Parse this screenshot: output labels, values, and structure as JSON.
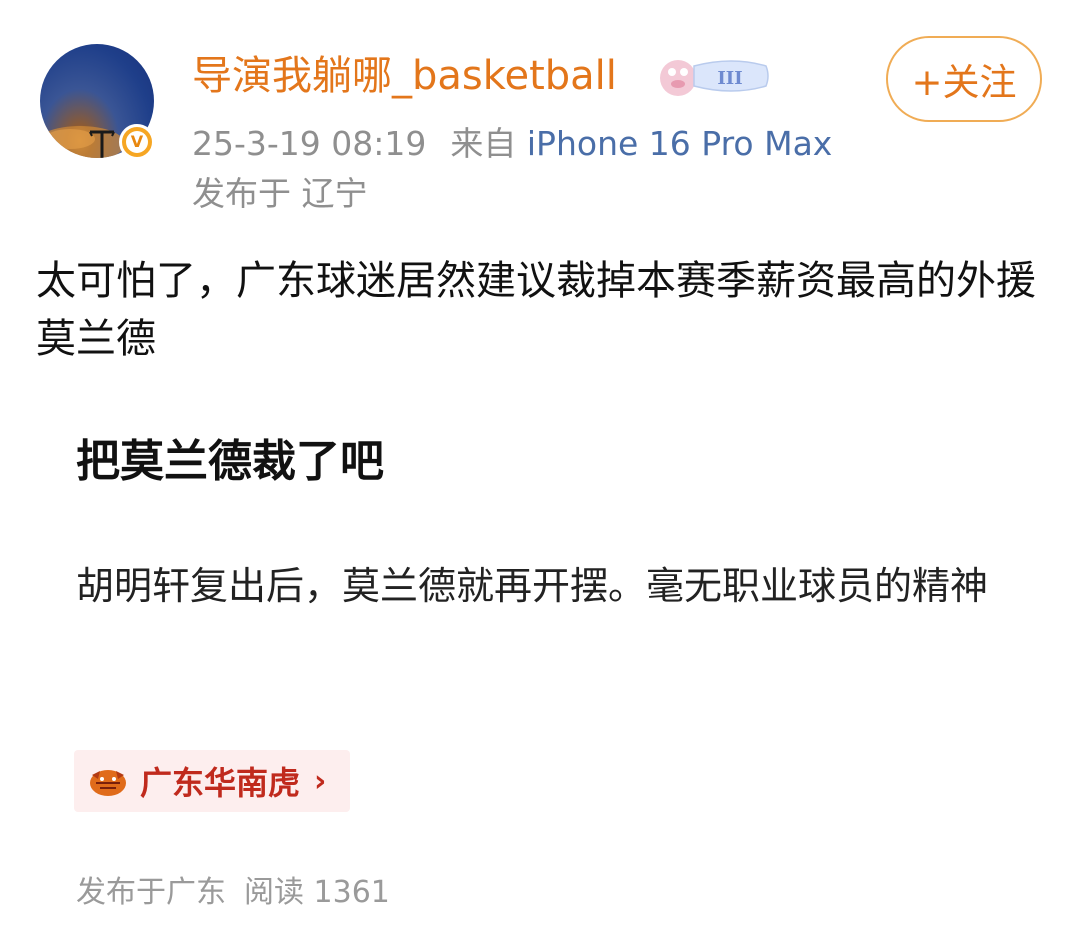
{
  "user": {
    "name": "导演我躺哪_basketball",
    "time": "25-3-19 08:19",
    "source_prefix": "来自",
    "device": "iPhone 16 Pro Max",
    "location": "发布于 辽宁",
    "follow_label": "+关注",
    "name_color": "#e3761b",
    "member_badge_icon": "member-level-badge-icon",
    "verify_icon": "verified-v-icon"
  },
  "post": {
    "text": "太可怕了，广东球迷居然建议裁掉本赛季薪资最高的外援莫兰德"
  },
  "card": {
    "title": "把莫兰德裁了吧",
    "body": "胡明轩复出后，莫兰德就再开摆。毫无职业球员的精神",
    "tag": {
      "icon": "tiger-logo-icon",
      "label": "广东华南虎",
      "chevron": "›"
    },
    "footer": {
      "location": "发布于广东",
      "reads": "阅读 1361"
    }
  }
}
